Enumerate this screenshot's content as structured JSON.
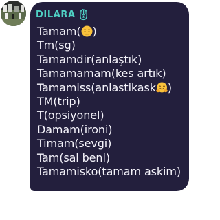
{
  "sender": {
    "name": "DILARA",
    "name_color": "#4fd1c4",
    "badge_icon": "hamsa-icon"
  },
  "message": {
    "bubble_color": "#231f3d",
    "text_color": "#f5f4fb",
    "lines": [
      {
        "before": "Tamam(",
        "emoji": "pensive-face-emoji",
        "after": ")"
      },
      {
        "text": "Tm(sg)"
      },
      {
        "text": "Tamamdir(anlaştık)"
      },
      {
        "text": "Tamamamam(kes artık)"
      },
      {
        "before": "Tamamiss(anlastikask",
        "emoji": "hugging-face-emoji",
        "after": ")"
      },
      {
        "text": "TM(trip)"
      },
      {
        "text": "T(opsiyonel)"
      },
      {
        "text": "Damam(ironi)"
      },
      {
        "text": "Timam(sevgi)"
      },
      {
        "text": "Tam(sal beni)"
      },
      {
        "text": "Tamamisko(tamam askim)"
      }
    ]
  }
}
